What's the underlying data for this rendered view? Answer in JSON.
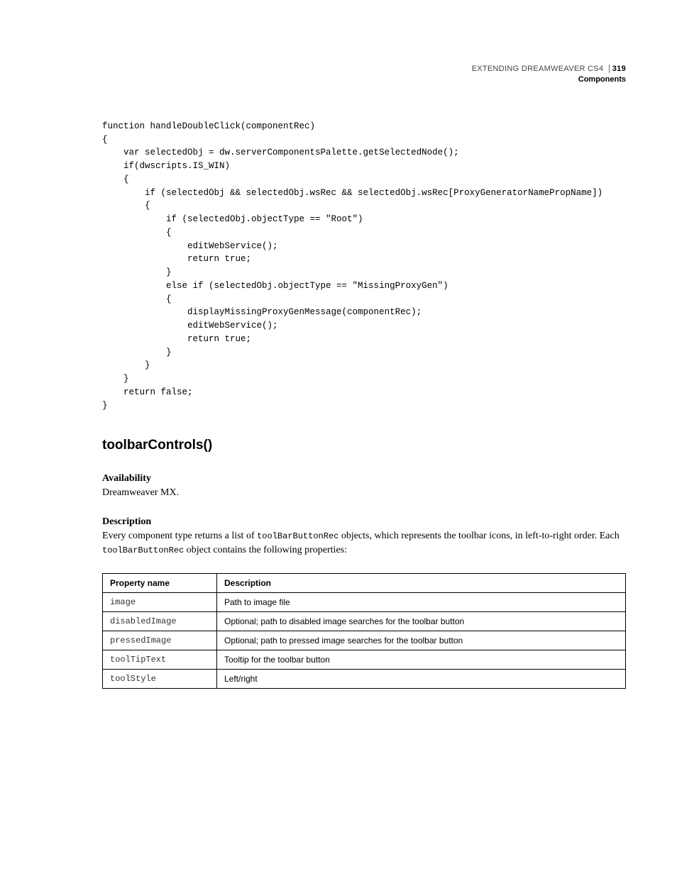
{
  "header": {
    "doc_title": "EXTENDING DREAMWEAVER CS4",
    "page_number": "319",
    "section": "Components"
  },
  "code_block": "function handleDoubleClick(componentRec)\n{\n    var selectedObj = dw.serverComponentsPalette.getSelectedNode();\n    if(dwscripts.IS_WIN)\n    {\n        if (selectedObj && selectedObj.wsRec && selectedObj.wsRec[ProxyGeneratorNamePropName])\n        {\n            if (selectedObj.objectType == \"Root\")\n            {\n                editWebService();\n                return true;\n            }\n            else if (selectedObj.objectType == \"MissingProxyGen\")\n            {\n                displayMissingProxyGenMessage(componentRec);\n                editWebService();\n                return true;\n            }\n        }\n    }\n    return false;\n}",
  "section_title": "toolbarControls()",
  "availability": {
    "heading": "Availability",
    "text": "Dreamweaver MX."
  },
  "description": {
    "heading": "Description",
    "text_pre": "Every component type returns a list of ",
    "code1": "toolBarButtonRec",
    "text_mid": " objects, which represents the toolbar icons, in left-to-right order. Each ",
    "code2": "toolBarButtonRec",
    "text_post": " object contains the following properties:"
  },
  "table": {
    "headers": {
      "col1": "Property name",
      "col2": "Description"
    },
    "rows": [
      {
        "prop": "image",
        "desc": "Path to image file"
      },
      {
        "prop": "disabledImage",
        "desc": "Optional; path to disabled image searches for the toolbar button"
      },
      {
        "prop": "pressedImage",
        "desc": "Optional; path to pressed image searches for the toolbar button"
      },
      {
        "prop": "toolTipText",
        "desc": "Tooltip for the toolbar button"
      },
      {
        "prop": "toolStyle",
        "desc": "Left/right"
      }
    ]
  }
}
